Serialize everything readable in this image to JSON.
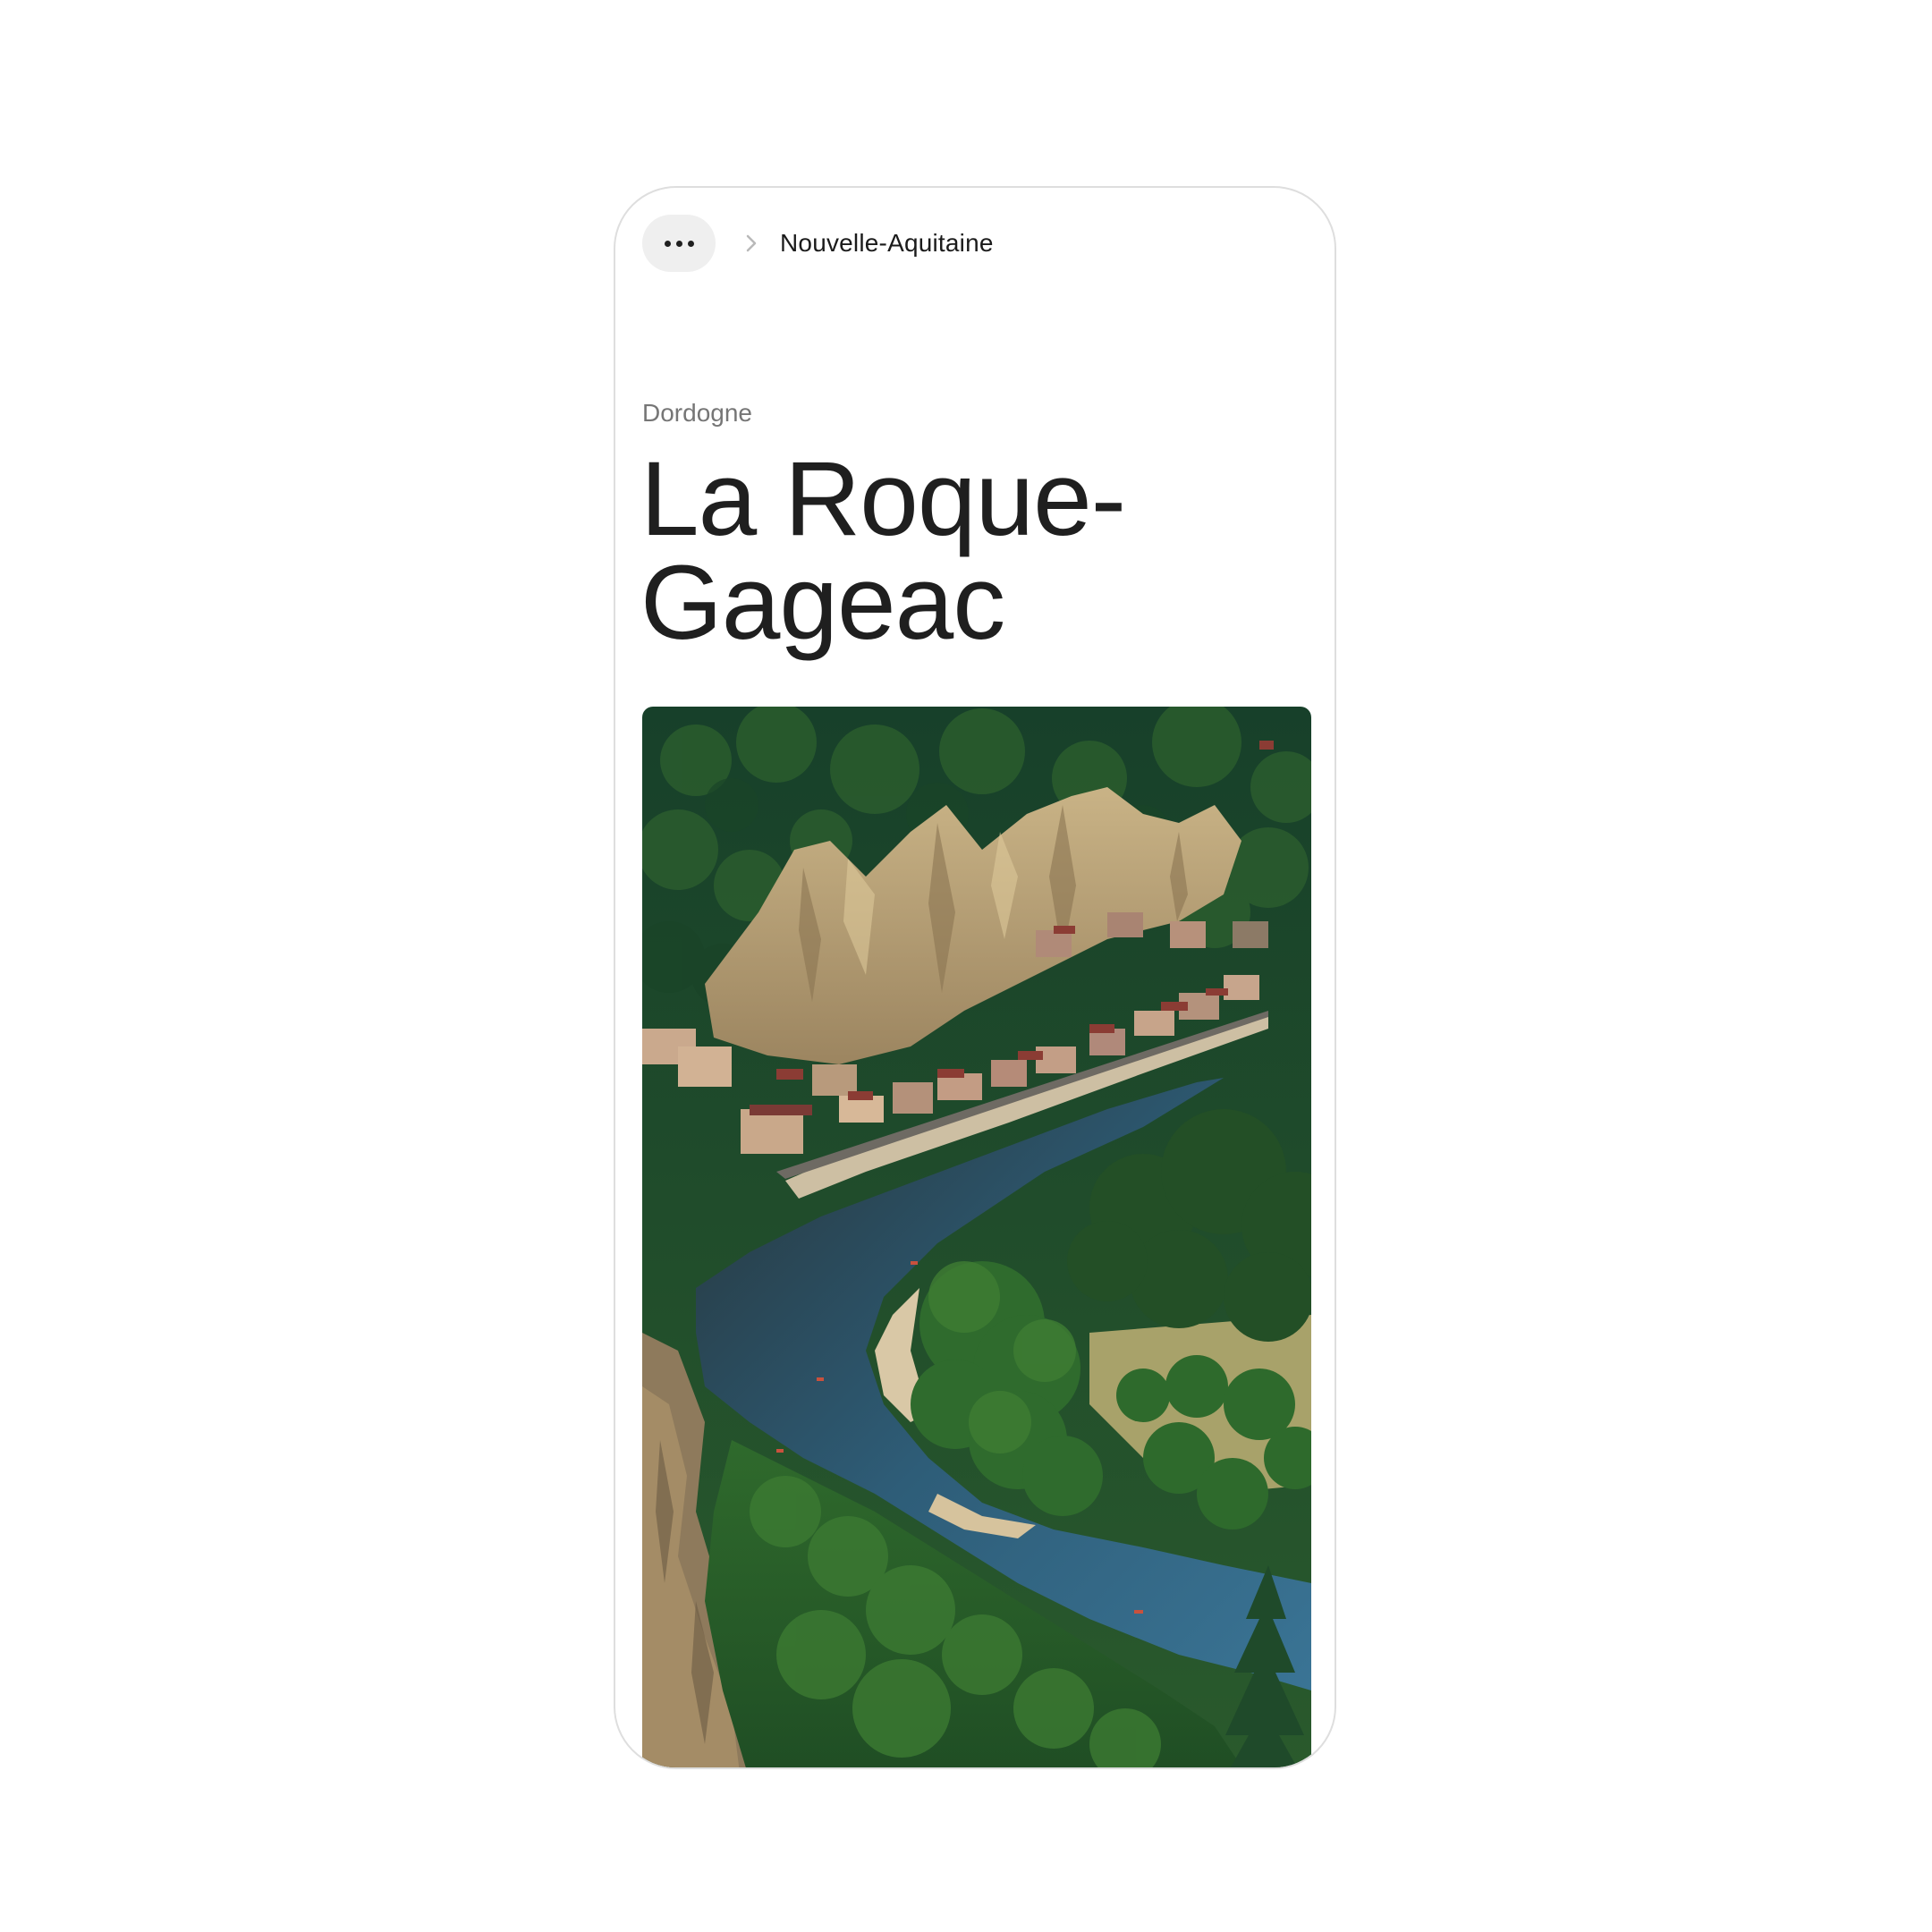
{
  "header": {
    "more_icon": "more-horizontal-icon",
    "separator_icon": "chevron-right-icon",
    "breadcrumb": "Nouvelle-Aquitaine"
  },
  "main": {
    "eyebrow": "Dordogne",
    "title": "La Roque-Gageac",
    "photo": {
      "subject": "aerial-view-village-cliff-river",
      "colors": {
        "forest": "#1f4a2a",
        "cliff": "#b8a27a",
        "river": "#2f5f7c",
        "sand": "#d9c8a6",
        "meadow": "#a8a26a"
      }
    }
  },
  "colors": {
    "text_primary": "#1f1f1f",
    "text_secondary": "#767676",
    "chip_bg": "#efefef",
    "frame_border": "#dedede"
  }
}
